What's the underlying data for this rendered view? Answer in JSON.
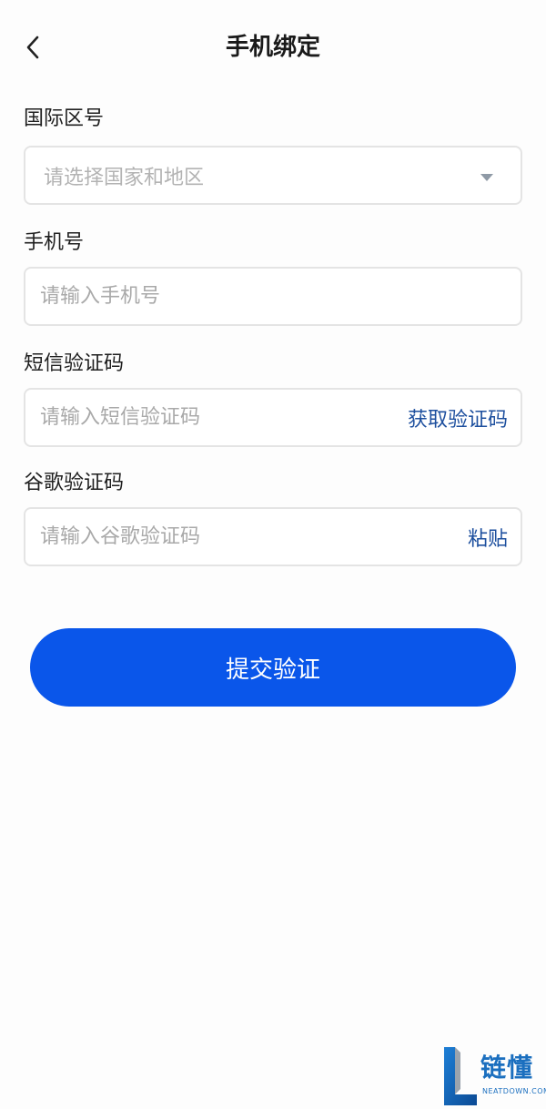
{
  "header": {
    "title": "手机绑定"
  },
  "form": {
    "region": {
      "label": "国际区号",
      "placeholder": "请选择国家和地区"
    },
    "phone": {
      "label": "手机号",
      "placeholder": "请输入手机号"
    },
    "sms": {
      "label": "短信验证码",
      "placeholder": "请输入短信验证码",
      "action": "获取验证码"
    },
    "google": {
      "label": "谷歌验证码",
      "placeholder": "请输入谷歌验证码",
      "action": "粘贴"
    },
    "submit_label": "提交验证"
  },
  "watermark": {
    "brand": "链懂",
    "domain": "NEATDOWN.COM"
  },
  "colors": {
    "primary": "#0a56ea",
    "link": "#1d4f9e",
    "border": "#e4e4e4"
  }
}
